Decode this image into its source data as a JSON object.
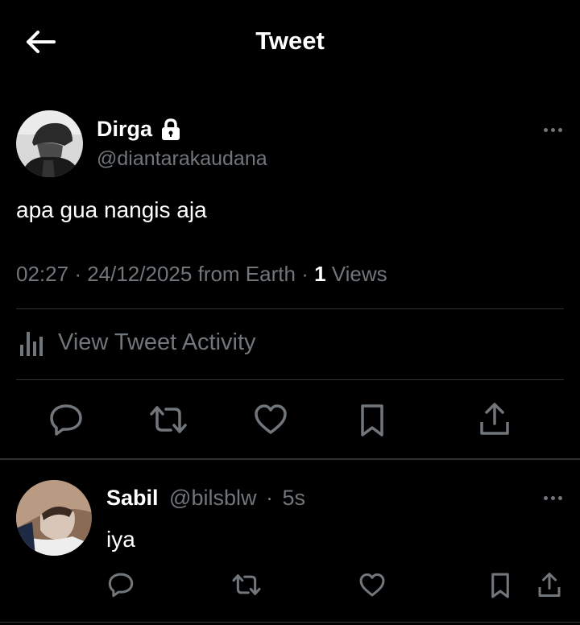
{
  "header": {
    "title": "Tweet"
  },
  "tweet": {
    "display_name": "Dirga",
    "handle": "@diantarakaudana",
    "text": "apa gua nangis aja",
    "time": "02:27",
    "date": "24/12/2025",
    "source": "from Earth",
    "views_count": "1",
    "views_label": "Views",
    "activity_label": "View Tweet Activity"
  },
  "reply": {
    "display_name": "Sabil",
    "handle": "@bilsblw",
    "age": "5s",
    "text": "iya"
  },
  "colors": {
    "background": "#000000",
    "primary_text": "#ffffff",
    "secondary_text": "#71767b",
    "divider": "#2f3336"
  },
  "icons": {
    "back": "arrow-left-icon",
    "lock": "lock-icon",
    "more": "more-horizontal-icon",
    "activity": "bar-chart-icon",
    "reply": "speech-bubble-icon",
    "retweet": "retweet-icon",
    "like": "heart-icon",
    "bookmark": "bookmark-icon",
    "share": "share-upload-icon"
  }
}
